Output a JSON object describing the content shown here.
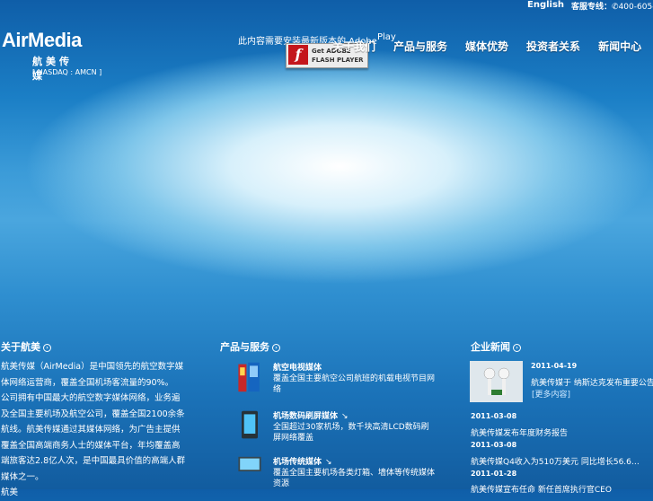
{
  "topbar": {
    "lang": "English",
    "hotline_label": "客服专线：",
    "hotline_number": "400-605-2286"
  },
  "logo": {
    "name": "AirMedia",
    "cn_name": "航美传媒",
    "listing": "[ NASDAQ : AMCN ]"
  },
  "flash": {
    "install_text": "此内容需要安装最新版本的 Adobe",
    "play_text": "Play",
    "badge_line1": "Get ADOBE",
    "badge_line2": "FLASH PLAYER"
  },
  "nav": [
    "关于我们",
    "产品与服务",
    "媒体优势",
    "投资者关系",
    "新闻中心"
  ],
  "sections": {
    "about_title": "关于航美",
    "products_title": "产品与服务",
    "news_title": "企业新闻"
  },
  "about": {
    "paragraphs": [
      "航美传媒（AirMedia）是中国领先的航空数字媒体网络运营商，覆盖全国机场客流量的90%。",
      "公司拥有中国最大的航空数字媒体网络，业务遍及全国主要机场及航空公司，覆盖全国2100余条航线。航美传媒通过其媒体网络，为广告主提供覆盖全国高端商务人士的媒体平台，年均覆盖高端旅客达2.8亿人次，是中国最具价值的高端人群媒体之一。",
      "航美"
    ]
  },
  "products": [
    {
      "title": "航空电视媒体",
      "desc": "覆盖全国主要航空公司航班的机载电视节目网络"
    },
    {
      "title": "机场数码刷屏媒体",
      "dl": "↘",
      "desc": "全国超过30家机场，数千块高清LCD数码刷屏网络覆盖"
    },
    {
      "title": "机场传统媒体",
      "dl": "↘",
      "desc": "覆盖全国主要机场各类灯箱、墙体等传统媒体资源"
    }
  ],
  "news": [
    {
      "date": "2011-04-19",
      "title": "航美传媒于 纳斯达克发布重要公告信息…",
      "more": "[更多内容]"
    },
    {
      "date": "2011-03-08",
      "title": "航美传媒发布年度财务报告"
    },
    {
      "date": "2011-03-08",
      "title": "航美传媒Q4收入为510万美元 同比增长56.6…"
    },
    {
      "date": "2011-01-28",
      "title": "航美传媒宣布任命 新任首席执行官CEO"
    }
  ]
}
